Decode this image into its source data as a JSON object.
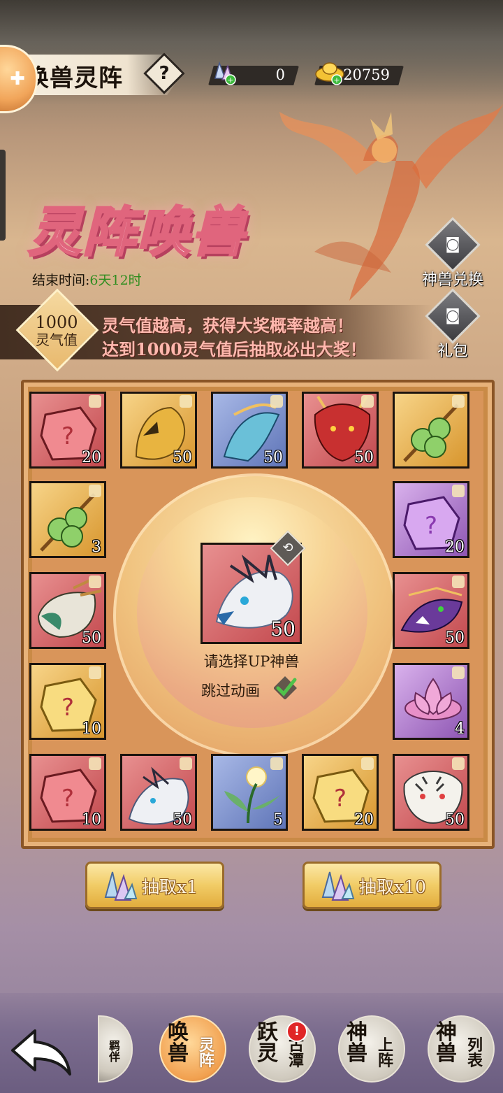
{
  "header": {
    "title": "唤兽灵阵",
    "help_label": "?",
    "crystal_count": "0",
    "gold_count": "20759"
  },
  "banner": {
    "title": "灵阵唤兽",
    "end_time_label": "结束时间:",
    "end_time_value": "6天12时",
    "lingqi_value": "1000",
    "lingqi_label": "灵气值",
    "tip_line1": "灵气值越高，获得大奖概率越高！",
    "tip_line2": "达到1000灵气值后抽取必出大奖！"
  },
  "side_buttons": {
    "exchange_label": "神兽兑换",
    "gift_label": "礼包"
  },
  "grid": {
    "cells": [
      {
        "type": "red-crystal",
        "count": "20"
      },
      {
        "type": "golden-griffin",
        "count": "50"
      },
      {
        "type": "azure-phoenix",
        "count": "50"
      },
      {
        "type": "red-dragon",
        "count": "50"
      },
      {
        "type": "green-fruit",
        "count": ""
      },
      {
        "type": "green-fruit",
        "count": "3"
      },
      {
        "type": "purple-crystal",
        "count": "20"
      },
      {
        "type": "green-dragon",
        "count": "50"
      },
      {
        "type": "purple-serpent",
        "count": "50"
      },
      {
        "type": "gold-crystal",
        "count": "10"
      },
      {
        "type": "lotus",
        "count": "4"
      },
      {
        "type": "red-crystal",
        "count": "10"
      },
      {
        "type": "white-dragon",
        "count": "50"
      },
      {
        "type": "spirit-herb",
        "count": "5"
      },
      {
        "type": "gold-crystal",
        "count": "20"
      },
      {
        "type": "white-tiger",
        "count": "50"
      }
    ]
  },
  "center": {
    "up_count": "50",
    "select_label": "请选择UP神兽",
    "skip_label": "跳过动画"
  },
  "draw": {
    "x1_label": "抽取x1",
    "x10_label": "抽取x10"
  },
  "nav": {
    "item1_partial": "羁伴",
    "item2_big": "唤兽",
    "item2_small": "灵阵",
    "item3_big": "跃灵",
    "item3_small": "古潭",
    "item3_badge": "!",
    "item4_big": "神兽",
    "item4_small": "上阵",
    "item5_big": "神兽",
    "item5_small": "列表"
  },
  "colors": {
    "accent_gold": "#f1cc66",
    "title_pink": "#e0657d",
    "tip_text": "#ffb8ae",
    "time_green": "#2f8d1f"
  }
}
